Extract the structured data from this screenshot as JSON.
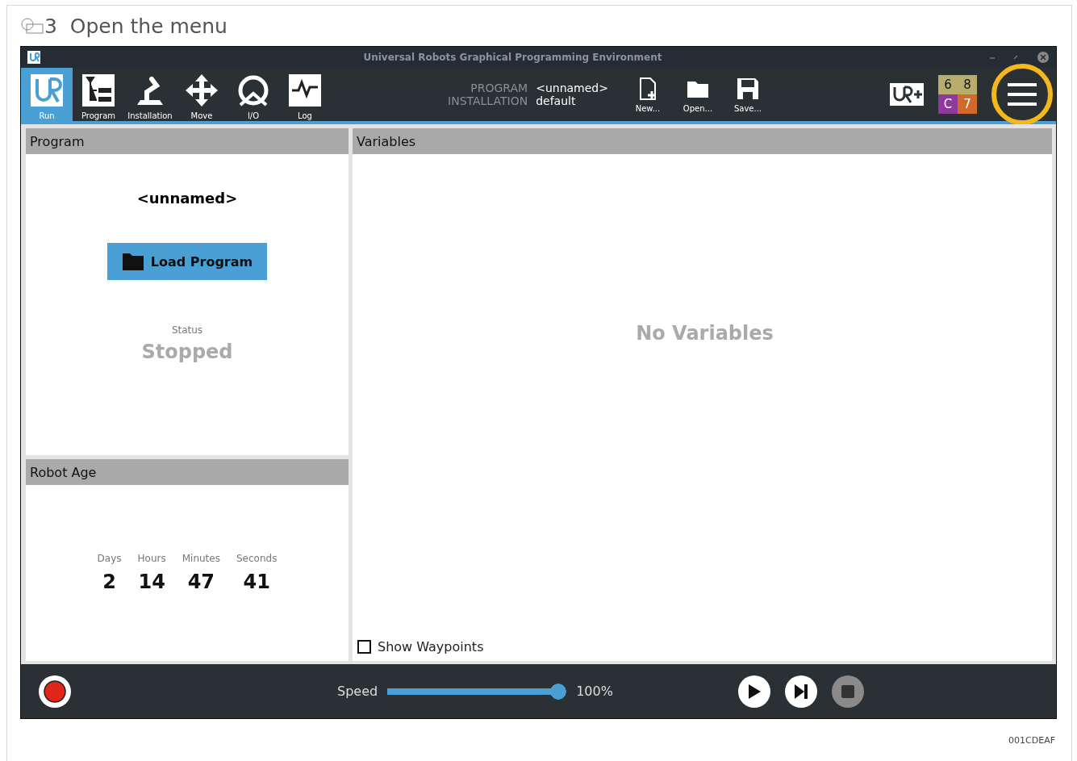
{
  "step": {
    "number": "3",
    "title": "Open the menu"
  },
  "window": {
    "title": "Universal Robots Graphical Programming Environment"
  },
  "tabs": [
    {
      "label": "Run",
      "selected": true
    },
    {
      "label": "Program",
      "selected": false
    },
    {
      "label": "Installation",
      "selected": false
    },
    {
      "label": "Move",
      "selected": false
    },
    {
      "label": "I/O",
      "selected": false
    },
    {
      "label": "Log",
      "selected": false
    }
  ],
  "file_info": [
    {
      "label": "PROGRAM",
      "value": "<unnamed>"
    },
    {
      "label": "INSTALLATION",
      "value": "default"
    }
  ],
  "file_buttons": [
    {
      "label": "New..."
    },
    {
      "label": "Open..."
    },
    {
      "label": "Save..."
    }
  ],
  "status_tiles": [
    {
      "label": "6",
      "color": "#b9ad6e"
    },
    {
      "label": "8",
      "color": "#b9ad6e"
    },
    {
      "label": "C",
      "color": "#8e3a9a"
    },
    {
      "label": "7",
      "color": "#d0692a"
    }
  ],
  "menu_button": {
    "highlighted": true
  },
  "program_panel": {
    "title": "Program",
    "name": "<unnamed>",
    "load_button": "Load Program",
    "status_label": "Status",
    "status": "Stopped"
  },
  "robot_age": {
    "title": "Robot Age",
    "units": [
      {
        "label": "Days",
        "value": "2"
      },
      {
        "label": "Hours",
        "value": "14"
      },
      {
        "label": "Minutes",
        "value": "47"
      },
      {
        "label": "Seconds",
        "value": "41"
      }
    ]
  },
  "variables": {
    "title": "Variables",
    "empty_text": "No Variables",
    "show_waypoints": {
      "label": "Show Waypoints",
      "checked": false
    }
  },
  "bottom_bar": {
    "speed_label": "Speed",
    "speed_reading": "100%",
    "controls": [
      {
        "kind": "play",
        "disabled": false
      },
      {
        "kind": "step",
        "disabled": false
      },
      {
        "kind": "stop",
        "disabled": true
      }
    ]
  },
  "footer_code": "001CDEAF"
}
